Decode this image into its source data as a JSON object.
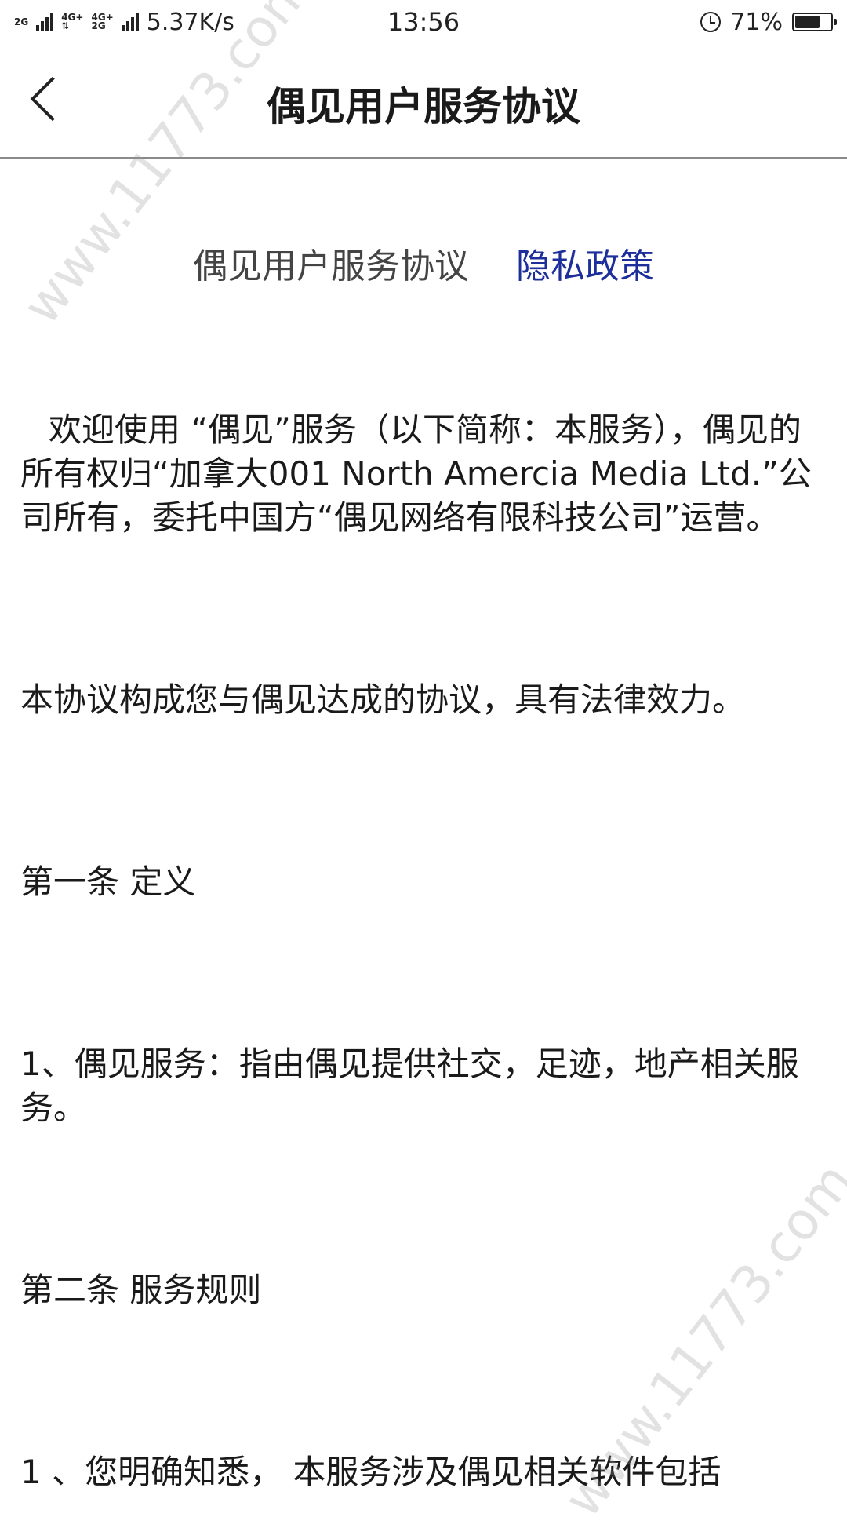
{
  "status_bar": {
    "net1": "2G",
    "net2_top": "4G+",
    "net2_bottom": "",
    "net3_top": "4G+",
    "net3_bottom": "2G",
    "speed": "5.37K/s",
    "time": "13:56",
    "battery_percent_text": "71%",
    "battery_level": 0.71
  },
  "header": {
    "title": "偶见用户服务协议"
  },
  "tabs": [
    {
      "label": "偶见用户服务协议"
    },
    {
      "label": "隐私政策"
    }
  ],
  "content": {
    "intro": "欢迎使用 “偶见”服务（以下简称：本服务），偶见的所有权归“加拿大001 North Amercia Media Ltd.”公司所有，委托中国方“偶见网络有限科技公司”运营。",
    "effect": "本协议构成您与偶见达成的协议，具有法律效力。",
    "article1_heading": "第一条 定义",
    "article1_item1": "1、偶见服务：指由偶见提供社交，足迹，地产相关服务。",
    "article2_heading": "第二条 服务规则",
    "article2_item1": "1 、您明确知悉， 本服务涉及偶见相关软件包括"
  },
  "watermark": {
    "text": "www.11773.com"
  }
}
